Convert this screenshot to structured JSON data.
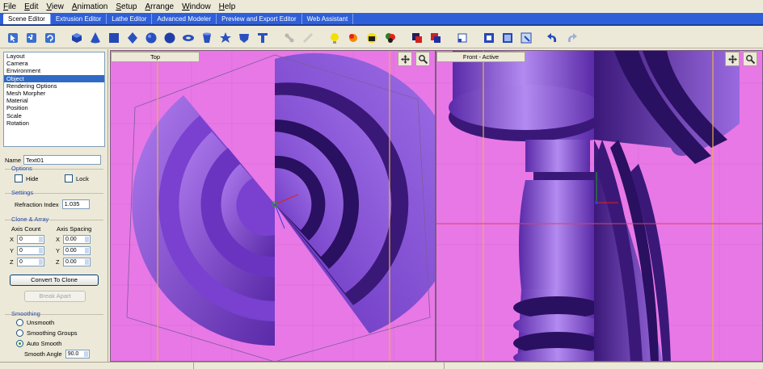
{
  "menu": [
    "File",
    "Edit",
    "View",
    "Animation",
    "Setup",
    "Arrange",
    "Window",
    "Help"
  ],
  "tabs": [
    {
      "label": "Scene Editor",
      "active": true
    },
    {
      "label": "Extrusion Editor",
      "active": false
    },
    {
      "label": "Lathe Editor",
      "active": false
    },
    {
      "label": "Advanced Modeler",
      "active": false
    },
    {
      "label": "Preview and Export Editor",
      "active": false
    },
    {
      "label": "Web Assistant",
      "active": false
    }
  ],
  "toolbar_icons": [
    "select-icon",
    "move-icon",
    "rotate-icon",
    "cube-icon",
    "cone-icon",
    "box-icon",
    "diamond-icon",
    "sphere-icon",
    "sphere-alt-icon",
    "torus-icon",
    "cylinder-icon",
    "star-icon",
    "shield-icon",
    "text-icon",
    "bone-icon",
    "spring-icon",
    "light-icon",
    "spot-light-icon",
    "camera-icon",
    "color-balls-icon",
    "material-icon",
    "paint-icon",
    "window-icon",
    "object-icon",
    "box-frame-icon",
    "render-icon",
    "undo-icon",
    "redo-icon"
  ],
  "properties": {
    "items": [
      "Layout",
      "Camera",
      "Environment",
      "Object",
      "Rendering Options",
      "Mesh Morpher",
      "Material",
      "Position",
      "Scale",
      "Rotation"
    ],
    "selected": "Object"
  },
  "object": {
    "name_label": "Name",
    "name_value": "Text01",
    "options_title": "Options",
    "hide_label": "Hide",
    "lock_label": "Lock",
    "settings_title": "Settings",
    "refraction_label": "Refraction Index",
    "refraction_value": "1.035",
    "clone_title": "Clone & Array",
    "axis_count_label": "Axis Count",
    "axis_spacing_label": "Axis Spacing",
    "rows": [
      {
        "axis": "X",
        "count": "0",
        "spacing": "0.00"
      },
      {
        "axis": "Y",
        "count": "0",
        "spacing": "0.00"
      },
      {
        "axis": "Z",
        "count": "0",
        "spacing": "0.00"
      }
    ],
    "convert_button": "Convert To Clone",
    "break_button": "Break Apart",
    "smoothing_title": "Smoothing",
    "smoothing_options": [
      "Unsmooth",
      "Smoothing Groups",
      "Auto Smooth"
    ],
    "smoothing_selected": "Auto Smooth",
    "smooth_angle_label": "Smooth Angle",
    "smooth_angle_value": "90.0"
  },
  "viewports": {
    "top_title": "Top",
    "front_title": "Front - Active"
  },
  "colors": {
    "viewport_bg": "#e878e6",
    "object_purple": "#8a4ee0",
    "tab_bar": "#2f5fd8",
    "selection": "#316ac5"
  }
}
